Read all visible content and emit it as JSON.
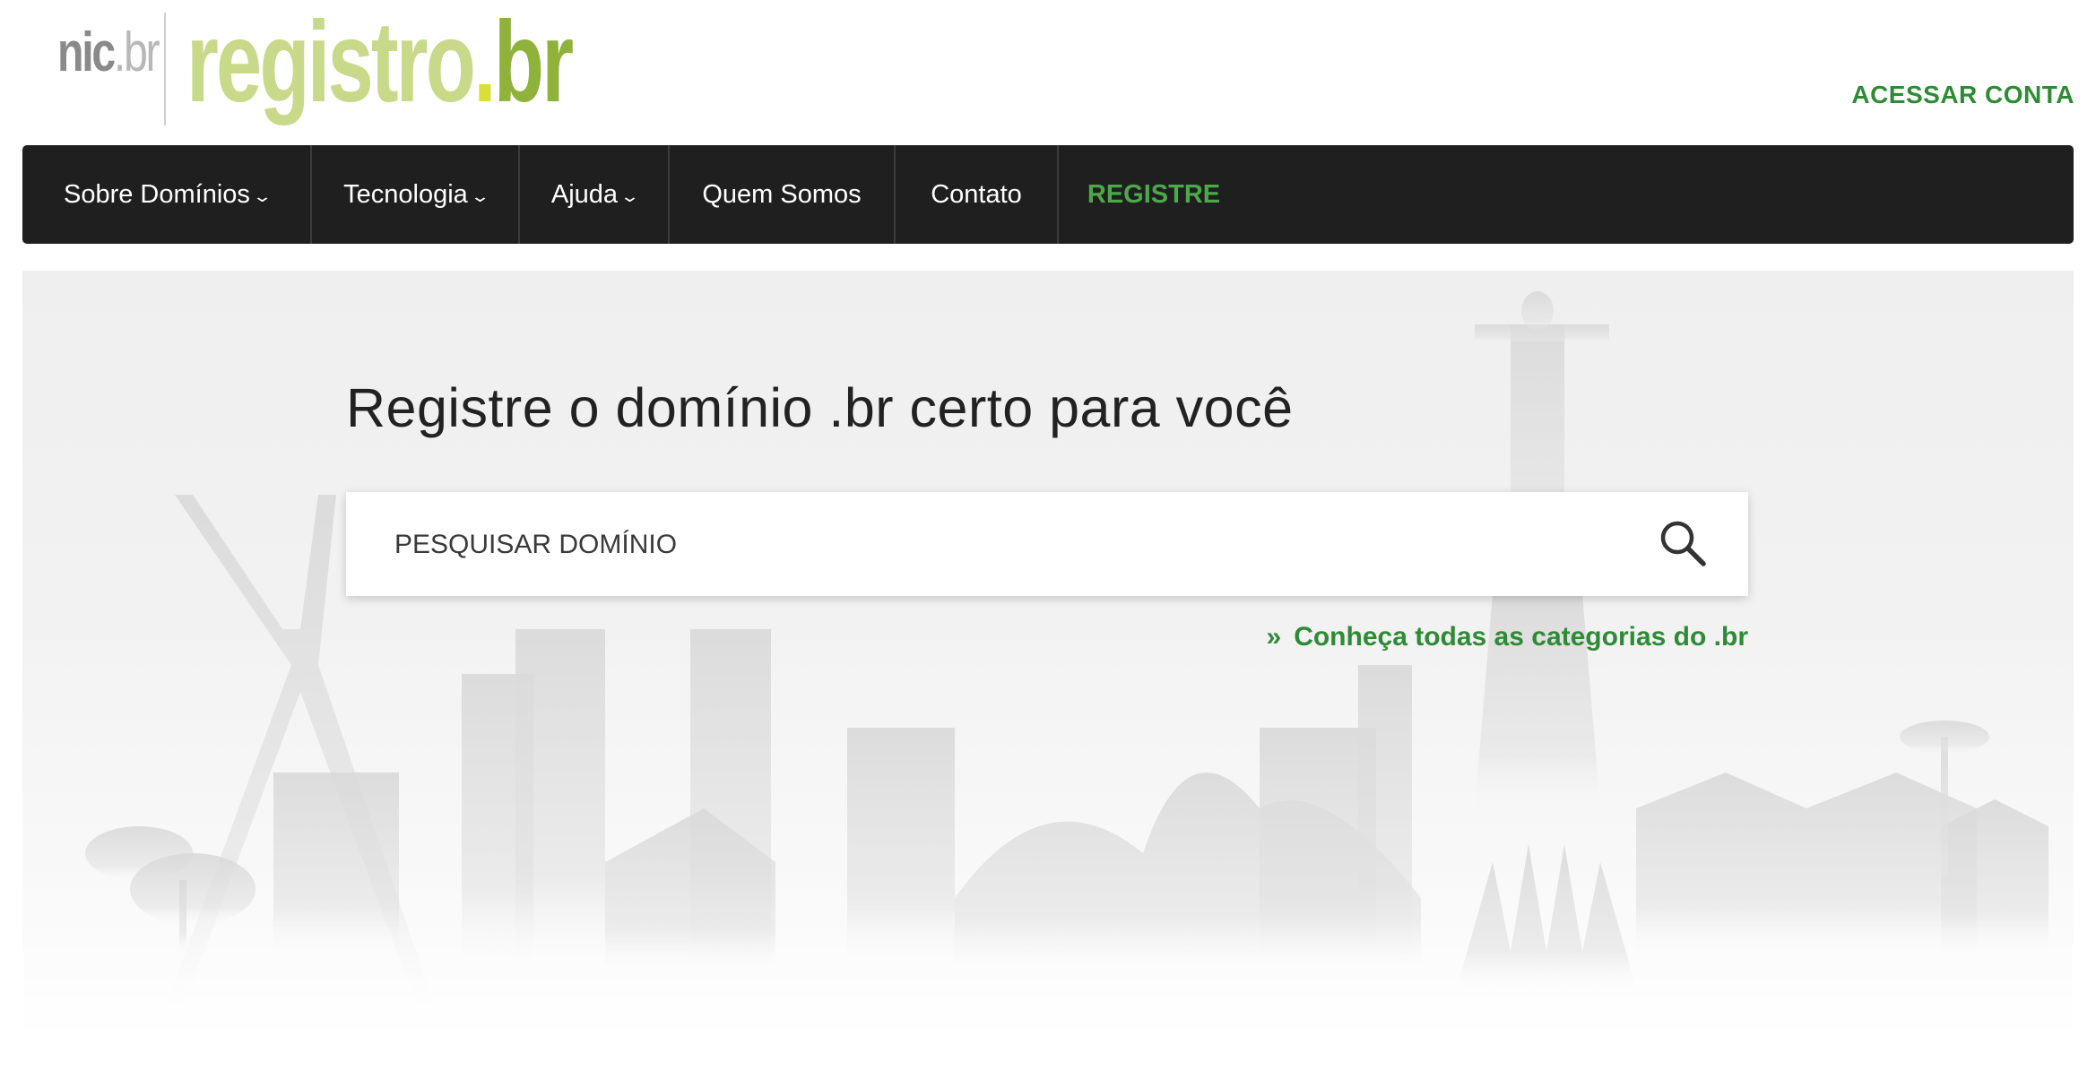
{
  "header": {
    "logo_nic": "nic",
    "logo_nic_suffix": ".br",
    "logo_registro": "registro",
    "logo_registro_dot": ".",
    "logo_registro_suffix": "br",
    "access_label": "ACESSAR CONTA"
  },
  "nav": {
    "items": [
      {
        "label": "Sobre Domínios",
        "dropdown": true
      },
      {
        "label": "Tecnologia",
        "dropdown": true
      },
      {
        "label": "Ajuda",
        "dropdown": true
      },
      {
        "label": "Quem Somos",
        "dropdown": false
      },
      {
        "label": "Contato",
        "dropdown": false
      },
      {
        "label": "REGISTRE",
        "dropdown": false
      }
    ],
    "chevron": "⌄"
  },
  "hero": {
    "title": "Registre o domínio .br certo para você",
    "search_placeholder": "PESQUISAR DOMÍNIO",
    "categories_arrow": "»",
    "categories_link": "Conheça todas as categorias do .br"
  },
  "colors": {
    "brand_green": "#2e8b35",
    "registre_green": "#4ca84a",
    "nav_bg": "#1f1f1f"
  }
}
